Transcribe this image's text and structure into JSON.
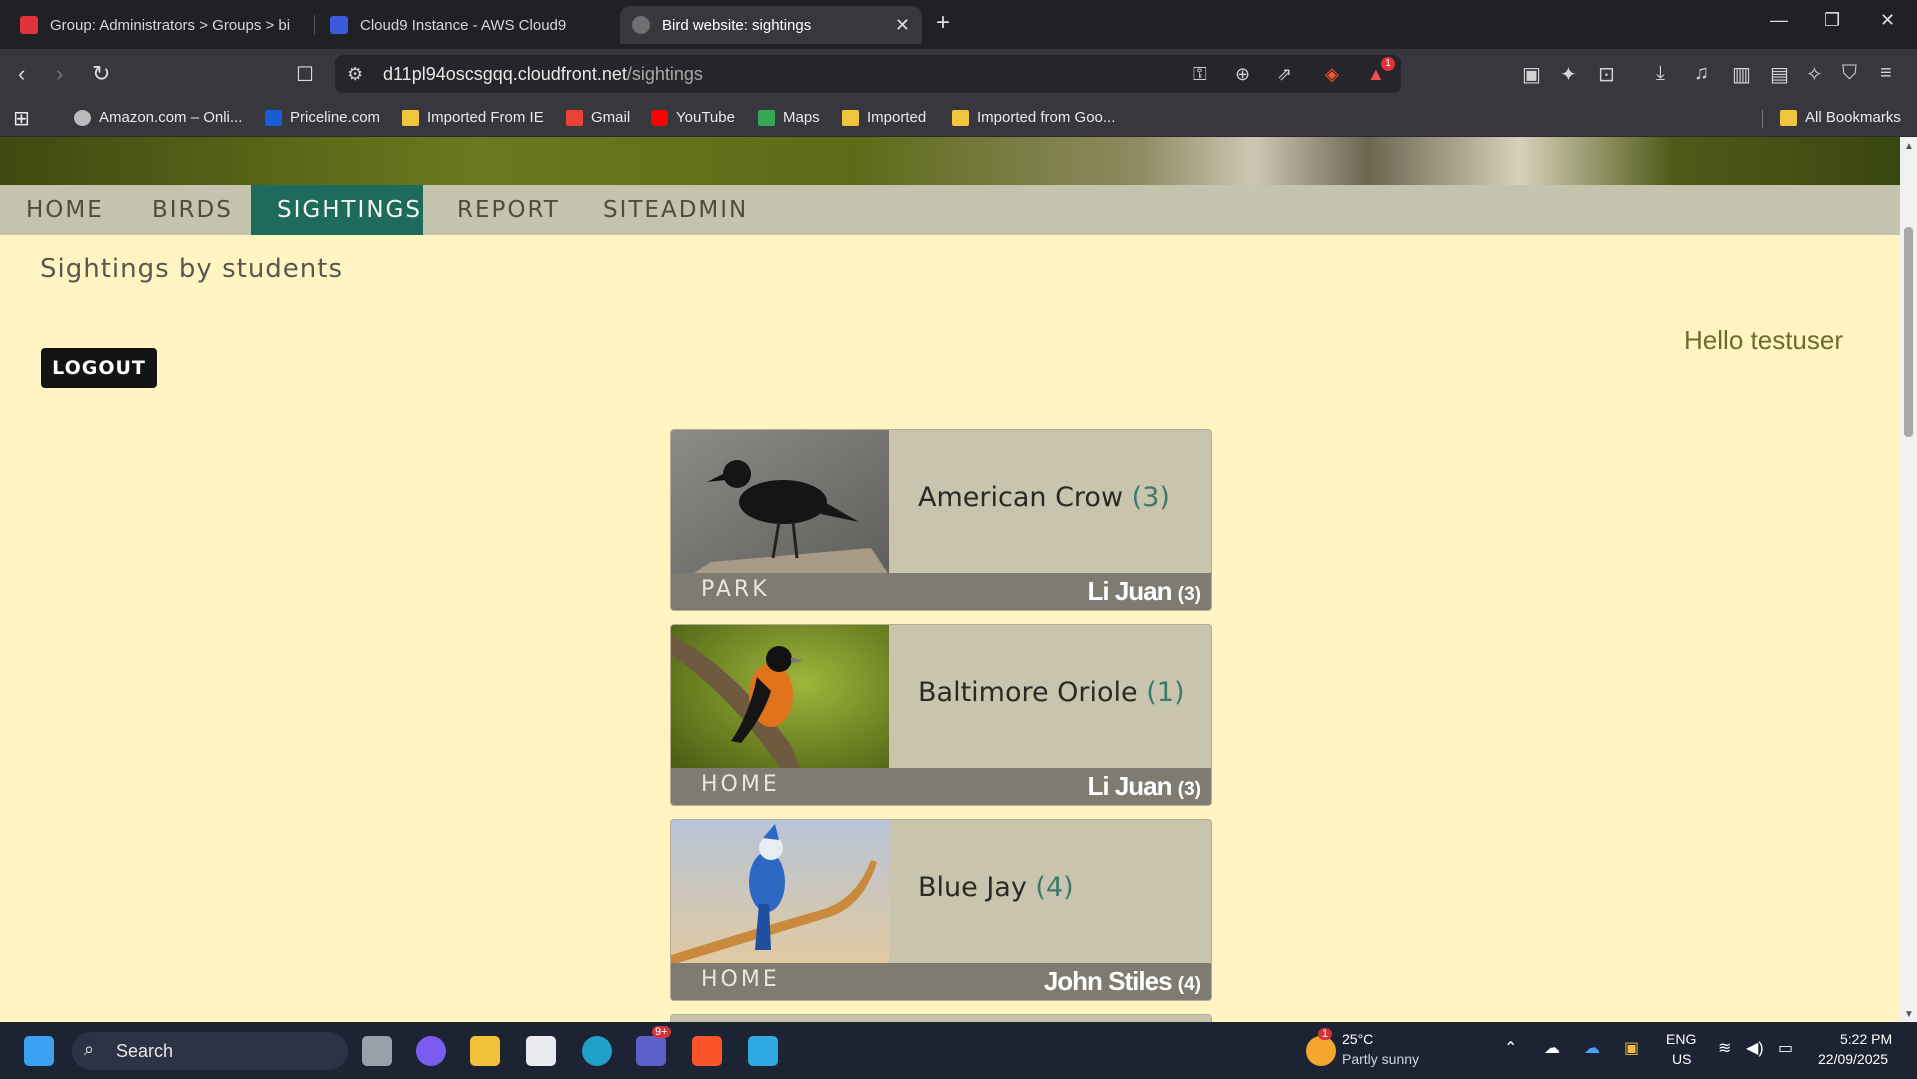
{
  "browser": {
    "tabs": [
      {
        "title": "Group: Administrators > Groups > bi",
        "favicon_color": "#e0323a"
      },
      {
        "title": "Cloud9 Instance - AWS Cloud9",
        "favicon_color": "#3b5bdb"
      },
      {
        "title": "Bird website: sightings",
        "favicon_color": "#6f6f6f"
      }
    ],
    "url_host": "d11pl94oscsgqq.cloudfront.net",
    "url_path": "/sightings",
    "notification_badge": "1",
    "bookmarks": [
      {
        "label": "Amazon.com – Onli...",
        "icon": "globe-icon"
      },
      {
        "label": "Priceline.com",
        "icon": "priceline-icon"
      },
      {
        "label": "Imported From IE",
        "icon": "folder-icon"
      },
      {
        "label": "Gmail",
        "icon": "gmail-icon"
      },
      {
        "label": "YouTube",
        "icon": "youtube-icon"
      },
      {
        "label": "Maps",
        "icon": "maps-icon"
      },
      {
        "label": "Imported",
        "icon": "folder-icon"
      },
      {
        "label": "Imported from Goo...",
        "icon": "folder-icon"
      }
    ],
    "all_bookmarks": "All Bookmarks"
  },
  "page": {
    "nav": [
      "HOME",
      "BIRDS",
      "SIGHTINGS",
      "REPORT",
      "SITEADMIN"
    ],
    "active_nav": "SIGHTINGS",
    "subtitle": "Sightings by students",
    "logout_label": "LOGOUT",
    "greeting": "Hello testuser",
    "sightings": [
      {
        "bird": "American Crow",
        "count": "(3)",
        "location": "PARK",
        "student": "Li Juan",
        "student_count": "(3)"
      },
      {
        "bird": "Baltimore Oriole",
        "count": "(1)",
        "location": "HOME",
        "student": "Li Juan",
        "student_count": "(3)"
      },
      {
        "bird": "Blue Jay",
        "count": "(4)",
        "location": "HOME",
        "student": "John Stiles",
        "student_count": "(4)"
      }
    ],
    "colors": {
      "background": "#fff4c2",
      "nav_bg": "#c4c3ad",
      "nav_active": "#1e6b5b",
      "card_bg": "#c9c4ad",
      "card_footer": "#7e7b70"
    }
  },
  "taskbar": {
    "search_label": "Search",
    "teams_badge": "9+",
    "weather_badge": "1",
    "temperature": "25°C",
    "weather": "Partly sunny",
    "lang_1": "ENG",
    "lang_2": "US",
    "time": "5:22 PM",
    "date": "22/09/2025"
  }
}
